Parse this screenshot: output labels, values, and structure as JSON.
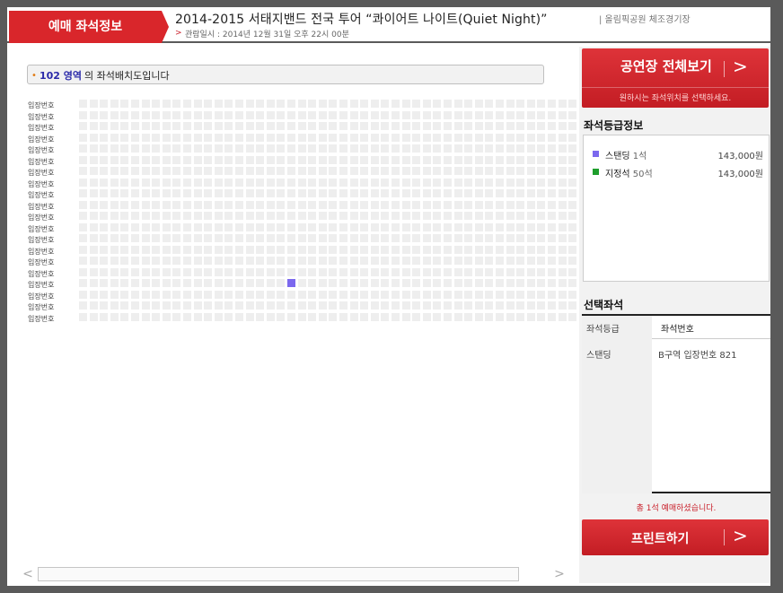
{
  "header": {
    "badge": "예매 좌석정보",
    "title": "2014-2015 서태지밴드 전국 투어 “콰이어트 나이트(Quiet Night)”",
    "venue": "| 올림픽공원 체조경기장",
    "date_arrow": ">",
    "date": "관람일시 : 2014년 12월 31일 오후 22시 00분"
  },
  "area": {
    "bullet": "•",
    "name": "102 영역",
    "suffix": "의 좌석배치도입니다"
  },
  "seat_map": {
    "row_label": "입장번호",
    "row_count": 20,
    "column_count": 48,
    "selected_seat": {
      "row": 16,
      "col": 20
    },
    "seat_color": "#eeeeee",
    "selected_color": "#7b68ee"
  },
  "scroll": {
    "left": "<",
    "right": ">"
  },
  "venue_button": {
    "label": "공연장 전체보기",
    "arrow": ">",
    "sub": "원하시는 좌석위치를 선택하세요."
  },
  "grade_info": {
    "title": "좌석등급정보",
    "items": [
      {
        "name": "스탠딩",
        "count": "1석",
        "price": "143,000원",
        "color": "#7b68ee"
      },
      {
        "name": "지정석",
        "count": "50석",
        "price": "143,000원",
        "color": "#1e9e2c"
      }
    ]
  },
  "selected_seats": {
    "title": "선택좌석",
    "head_grade": "좌석등급",
    "head_seat": "좌석번호",
    "row_grade": "스탠딩",
    "row_seat": "B구역 입장번호 821"
  },
  "total": "총 1석 예매하셨습니다.",
  "print_button": {
    "label": "프린트하기",
    "arrow": ">"
  }
}
